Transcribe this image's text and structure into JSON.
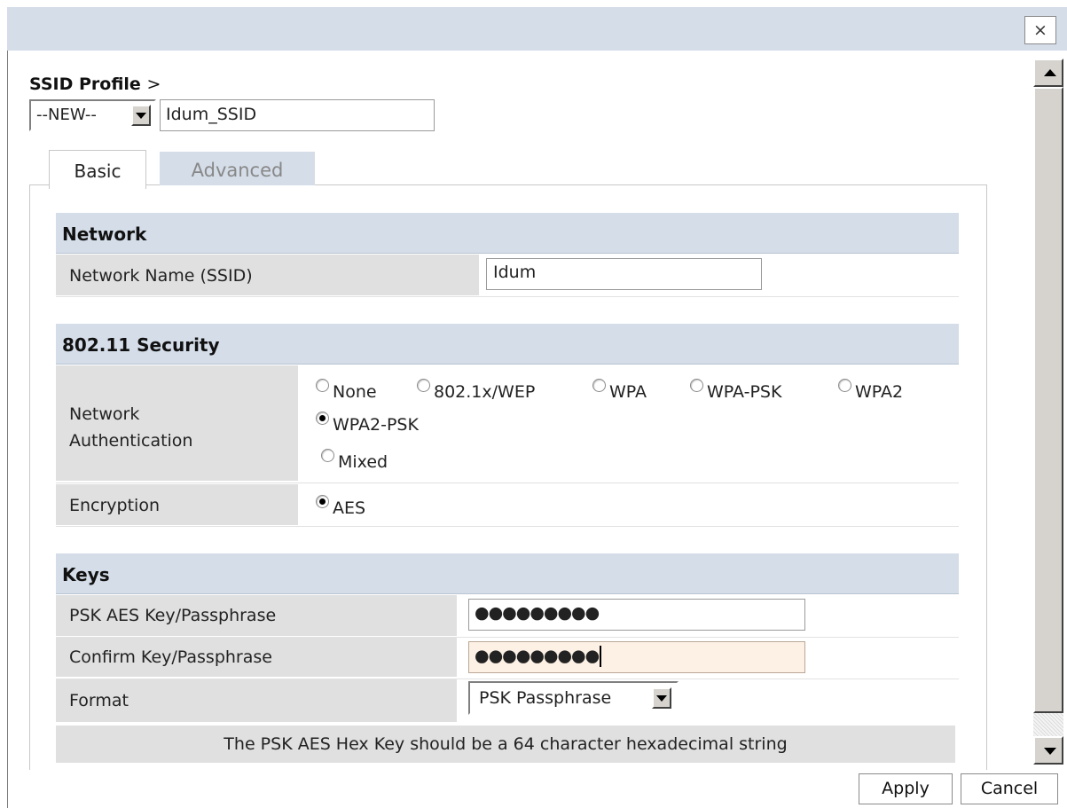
{
  "dialog": {
    "close_label": "×"
  },
  "profile": {
    "label": "SSID Profile",
    "separator": ">",
    "select_value": "--NEW--",
    "name_value": "Idum_SSID"
  },
  "tabs": [
    {
      "label": "Basic",
      "active": true
    },
    {
      "label": "Advanced",
      "active": false
    }
  ],
  "network": {
    "header": "Network",
    "ssid_label": "Network Name (SSID)",
    "ssid_value": "Idum"
  },
  "security": {
    "header": "802.11 Security",
    "auth_label_line1": "Network",
    "auth_label_line2": "Authentication",
    "auth_options": [
      "None",
      "802.1x/WEP",
      "WPA",
      "WPA-PSK",
      "WPA2",
      "WPA2-PSK",
      "Mixed"
    ],
    "auth_selected": "WPA2-PSK",
    "encryption_label": "Encryption",
    "encryption_options": [
      "AES"
    ],
    "encryption_selected": "AES"
  },
  "keys": {
    "header": "Keys",
    "psk_label": "PSK AES Key/Passphrase",
    "psk_mask": "●●●●●●●●●",
    "confirm_label": "Confirm Key/Passphrase",
    "confirm_mask": "●●●●●●●●●",
    "format_label": "Format",
    "format_value": "PSK Passphrase",
    "note": "The PSK AES Hex Key should be a 64 character hexadecimal string"
  },
  "footer": {
    "apply_label": "Apply",
    "cancel_label": "Cancel"
  },
  "colors": {
    "header_bg": "#d4dde8",
    "label_bg": "#e0e0e0",
    "focus_bg": "#fdf0e4"
  }
}
